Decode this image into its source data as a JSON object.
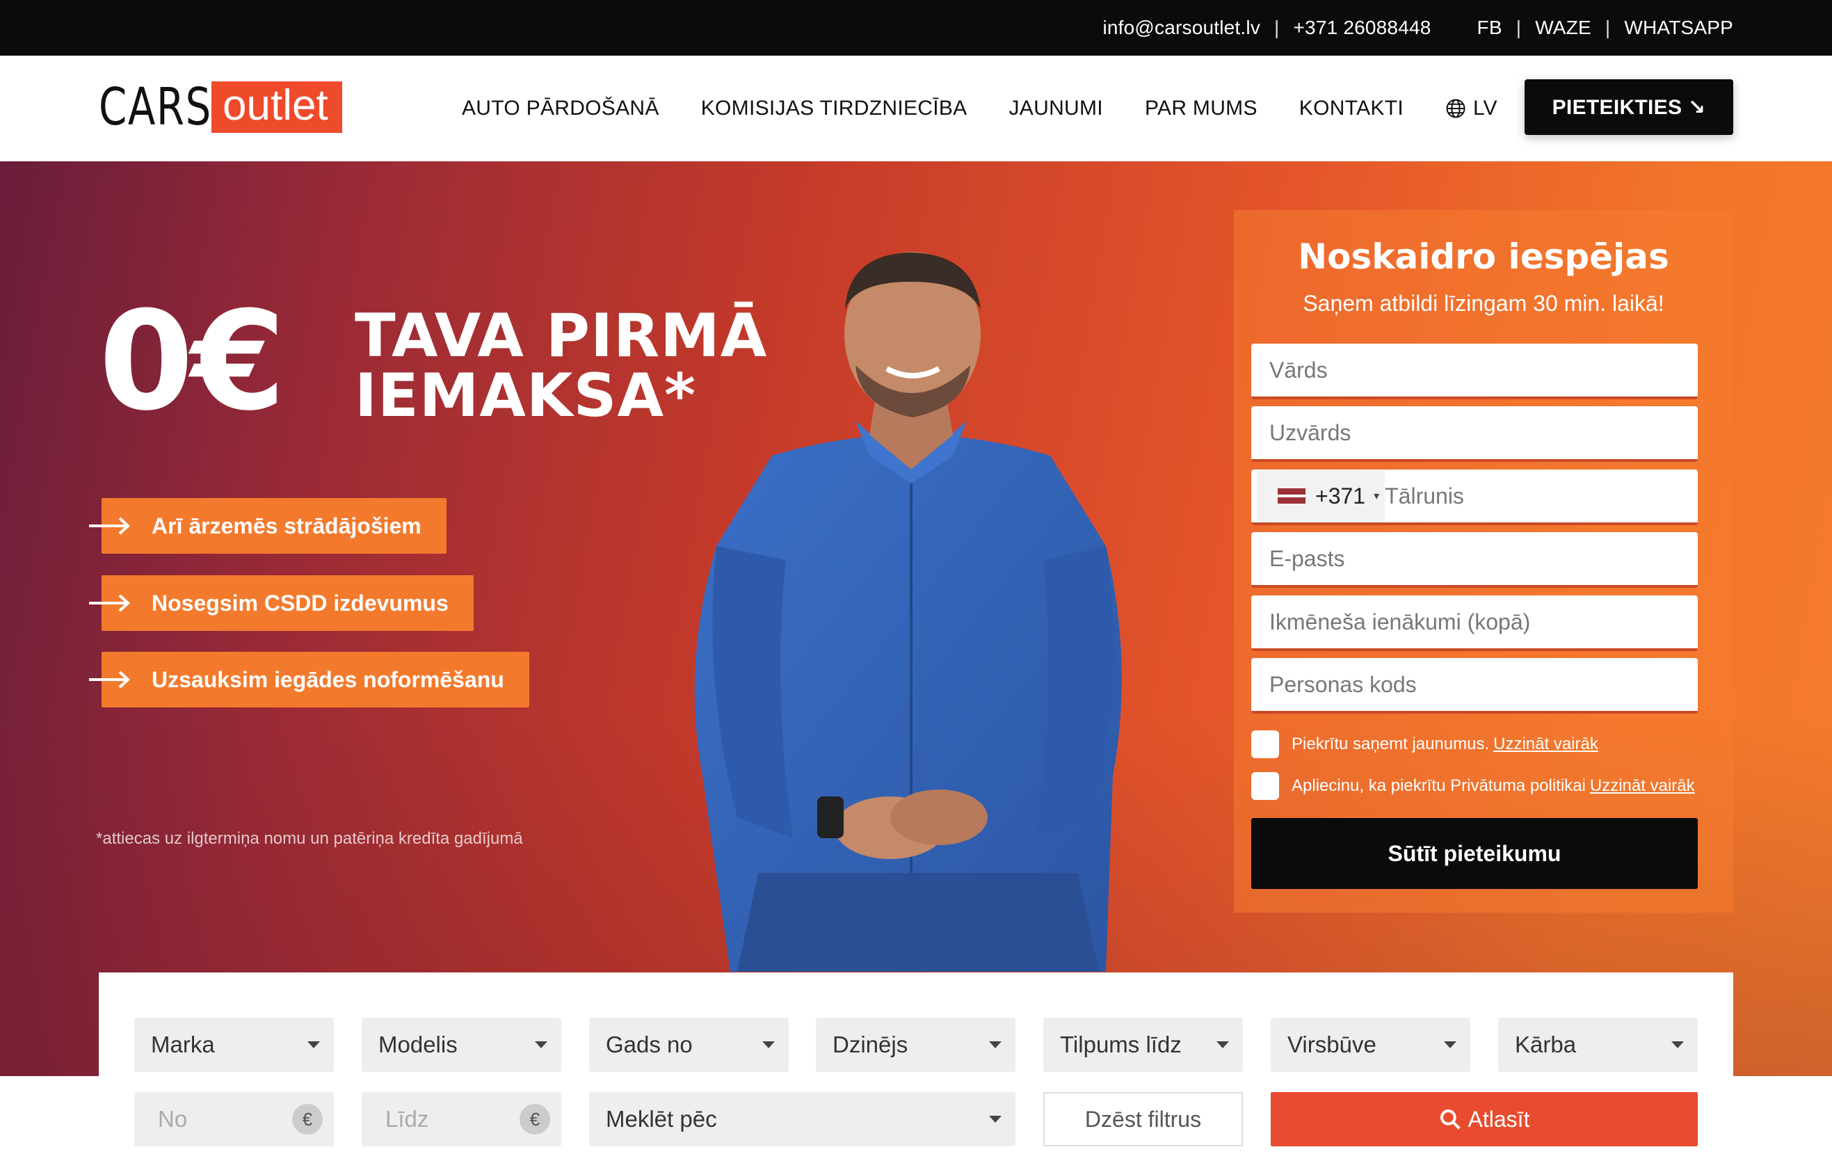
{
  "topbar": {
    "email": "info@carsoutlet.lv",
    "phone": "+371 26088448",
    "links": [
      "FB",
      "WAZE",
      "WHATSAPP"
    ]
  },
  "header": {
    "logo_left": "CARS",
    "logo_right": "outlet",
    "nav": [
      "AUTO PĀRDOŠANĀ",
      "KOMISIJAS TIRDZNIECĪBA",
      "JAUNUMI",
      "PAR MUMS",
      "KONTAKTI"
    ],
    "lang": "LV",
    "cta": "PIETEIKTIES ↘"
  },
  "hero": {
    "amount": "0€",
    "line1": "TAVA PIRMĀ",
    "line2": "IEMAKSA*",
    "benefits": [
      "Arī ārzemēs strādājošiem",
      "Nosegsim CSDD izdevumus",
      "Uzsauksim iegādes noformēšanu"
    ],
    "footnote": "*attiecas uz ilgtermiņa nomu un patēriņa kredīta gadījumā"
  },
  "form": {
    "title": "Noskaidro iespējas",
    "subtitle": "Saņem atbildi līzingam 30 min. laikā!",
    "first_name": "Vārds",
    "last_name": "Uzvārds",
    "phone_prefix": "+371",
    "phone": "Tālrunis",
    "email": "E-pasts",
    "income": "Ikmēneša ienākumi (kopā)",
    "personal_code": "Personas kods",
    "consent_news": "Piekrītu saņemt jaunumus.",
    "consent_privacy": "Apliecinu, ka piekrītu Privātuma politikai",
    "more_link": "Uzzināt vairāk",
    "submit": "Sūtīt pieteikumu"
  },
  "filters": {
    "selects": [
      "Marka",
      "Modelis",
      "Gads no",
      "Dzinējs",
      "Tilpums līdz",
      "Virsbūve",
      "Kārba"
    ],
    "price_from": "No",
    "price_to": "Līdz",
    "currency": "€",
    "search_by": "Meklēt pēc",
    "clear": "Dzēst filtrus",
    "submit": "Atlasīt"
  },
  "colors": {
    "accent": "#ee4b2b",
    "pill": "#f37a2d",
    "dark": "#0b0b0b"
  }
}
